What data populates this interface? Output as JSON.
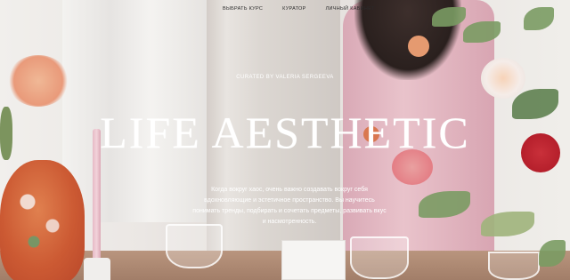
{
  "nav": {
    "items": [
      {
        "label": "ВЫБРАТЬ КУРС"
      },
      {
        "label": "КУРАТОР"
      },
      {
        "label": "ЛИЧНЫЙ КАБИНЕТ"
      }
    ]
  },
  "hero": {
    "curated_by": "CURATED BY VALERIA SERGEEVA",
    "title": "LIFE AESTHETIC",
    "description": "Когда вокруг хаос, очень важно создавать вокруг себя вдохновляющие и эстетичное пространство. Вы научитесь понимать тренды, подбирать и сочетать предметы, развивать вкус и насмотренность."
  },
  "colors": {
    "text": "#ffffff",
    "nav_text": "#2b2b2b"
  }
}
